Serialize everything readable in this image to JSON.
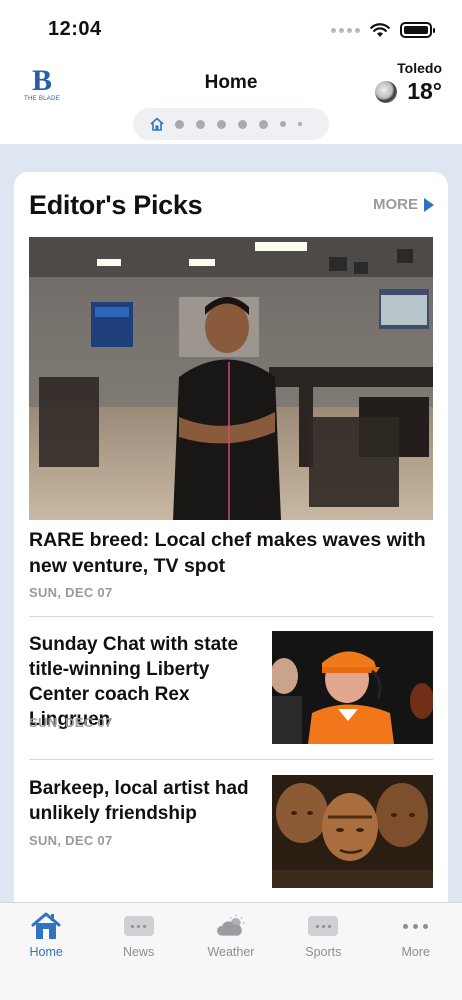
{
  "status_bar": {
    "time": "12:04"
  },
  "header": {
    "logo_letter": "B",
    "logo_text": "THE BLADE",
    "title": "Home",
    "weather": {
      "city": "Toledo",
      "temp": "18°",
      "icon": "moon-cloud-icon"
    }
  },
  "editors_picks": {
    "title": "Editor's Picks",
    "more_label": "MORE",
    "stories": [
      {
        "headline": "RARE breed: Local chef makes waves with new venture, TV spot",
        "date": "SUN, DEC 07",
        "image": "chef-photo"
      },
      {
        "headline": "Sunday Chat with state title-winning Liberty Center coach Rex Lingruen",
        "date": "SUN, DEC 07",
        "image": "coach-photo"
      },
      {
        "headline": "Barkeep, local artist had unlikely friendship",
        "date": "SUN, DEC 07",
        "image": "sculpture-photo"
      }
    ]
  },
  "tab_bar": {
    "tabs": [
      {
        "label": "Home",
        "icon": "house-icon",
        "active": true
      },
      {
        "label": "News",
        "icon": "news-icon",
        "active": false
      },
      {
        "label": "Weather",
        "icon": "cloud-sun-icon",
        "active": false
      },
      {
        "label": "Sports",
        "icon": "sports-icon",
        "active": false
      },
      {
        "label": "More",
        "icon": "more-icon",
        "active": false
      }
    ]
  },
  "colors": {
    "accent": "#2f74c0",
    "page_bg": "#dde6f1",
    "muted_text": "#9a9a9a"
  }
}
